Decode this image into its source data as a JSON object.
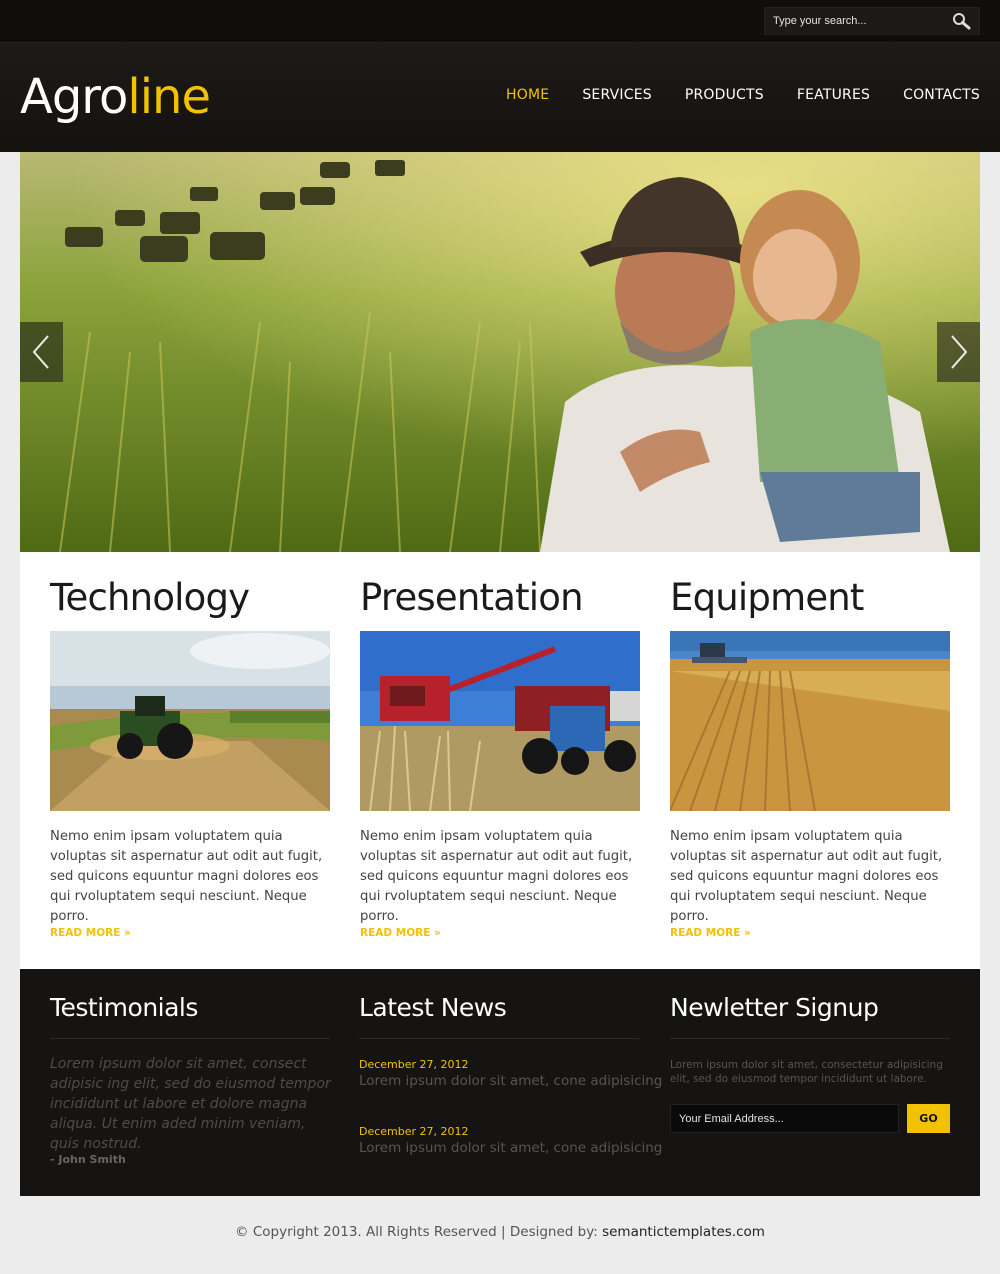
{
  "search": {
    "placeholder": "Type your search..."
  },
  "brand": {
    "part1": "Agro",
    "part2": "line"
  },
  "nav": [
    {
      "label": "HOME",
      "active": true
    },
    {
      "label": "SERVICES",
      "active": false
    },
    {
      "label": "PRODUCTS",
      "active": false
    },
    {
      "label": "FEATURES",
      "active": false
    },
    {
      "label": "CONTACTS",
      "active": false
    }
  ],
  "hero": {
    "prev_icon": "chevron-left-icon",
    "next_icon": "chevron-right-icon"
  },
  "features": [
    {
      "title": "Technology",
      "image": "tractor-field-photo",
      "text": "Nemo enim ipsam voluptatem quia voluptas sit aspernatur aut odit aut fugit, sed quicons equuntur magni dolores eos qui rvoluptatem sequi nesciunt. Neque porro.",
      "more": "READ MORE »"
    },
    {
      "title": "Presentation",
      "image": "harvester-photo",
      "text": "Nemo enim ipsam voluptatem quia voluptas sit aspernatur aut odit aut fugit, sed quicons equuntur magni dolores eos qui rvoluptatem sequi nesciunt. Neque porro.",
      "more": "READ MORE »"
    },
    {
      "title": "Equipment",
      "image": "wheat-field-photo",
      "text": "Nemo enim ipsam voluptatem quia voluptas sit aspernatur aut odit aut fugit, sed quicons equuntur magni dolores eos qui rvoluptatem sequi nesciunt. Neque porro.",
      "more": "READ MORE »"
    }
  ],
  "testimonials": {
    "title": "Testimonials",
    "quote": "Lorem ipsum dolor sit amet, consect adipisic ing elit, sed do eiusmod tempor incididunt ut labore et dolore magna aliqua. Ut enim aded minim veniam, quis nostrud.",
    "author": "- John Smith"
  },
  "news": {
    "title": "Latest News",
    "items": [
      {
        "date": "December 27, 2012",
        "text": "Lorem ipsum dolor sit amet, cone adipisicing"
      },
      {
        "date": "December 27, 2012",
        "text": "Lorem ipsum dolor sit amet, cone adipisicing"
      }
    ]
  },
  "newsletter": {
    "title": "Newletter Signup",
    "text": "Lorem ipsum dolor sit amet, consectetur adipisicing elit, sed do eiusmod tempor incididunt ut labore.",
    "placeholder": "Your Email Address...",
    "button": "GO"
  },
  "footer": {
    "copyright": "© Copyright 2013. All Rights Reserved  |  Designed by: ",
    "link": "semantictemplates.com"
  },
  "colors": {
    "accent": "#f2c200",
    "dark": "#151413",
    "header": "#1d1a17"
  }
}
